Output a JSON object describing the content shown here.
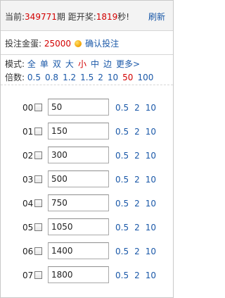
{
  "header": {
    "current_label": "当前:",
    "period": "349771",
    "period_suffix": "期",
    "draw_label": "距开奖:",
    "seconds": "1819",
    "seconds_suffix": "秒!",
    "refresh": "刷新"
  },
  "bet": {
    "label": "投注金蛋:",
    "amount": "25000",
    "confirm": "确认投注"
  },
  "modes": {
    "label": "模式:",
    "items": [
      "全",
      "单",
      "双",
      "大",
      "小",
      "中",
      "边",
      "更多>"
    ]
  },
  "multipliers": {
    "label": "倍数:",
    "items": [
      "0.5",
      "0.8",
      "1.2",
      "1.5",
      "2",
      "10",
      "50",
      "100"
    ]
  },
  "rows": [
    {
      "num": "00",
      "value": "50"
    },
    {
      "num": "01",
      "value": "150"
    },
    {
      "num": "02",
      "value": "300"
    },
    {
      "num": "03",
      "value": "500"
    },
    {
      "num": "04",
      "value": "750"
    },
    {
      "num": "05",
      "value": "1050"
    },
    {
      "num": "06",
      "value": "1400"
    },
    {
      "num": "07",
      "value": "1800"
    }
  ],
  "quick_multipliers": [
    "0.5",
    "2",
    "10"
  ],
  "colors": {
    "accent_red": "#d20000",
    "link_blue": "#1a58a8"
  }
}
